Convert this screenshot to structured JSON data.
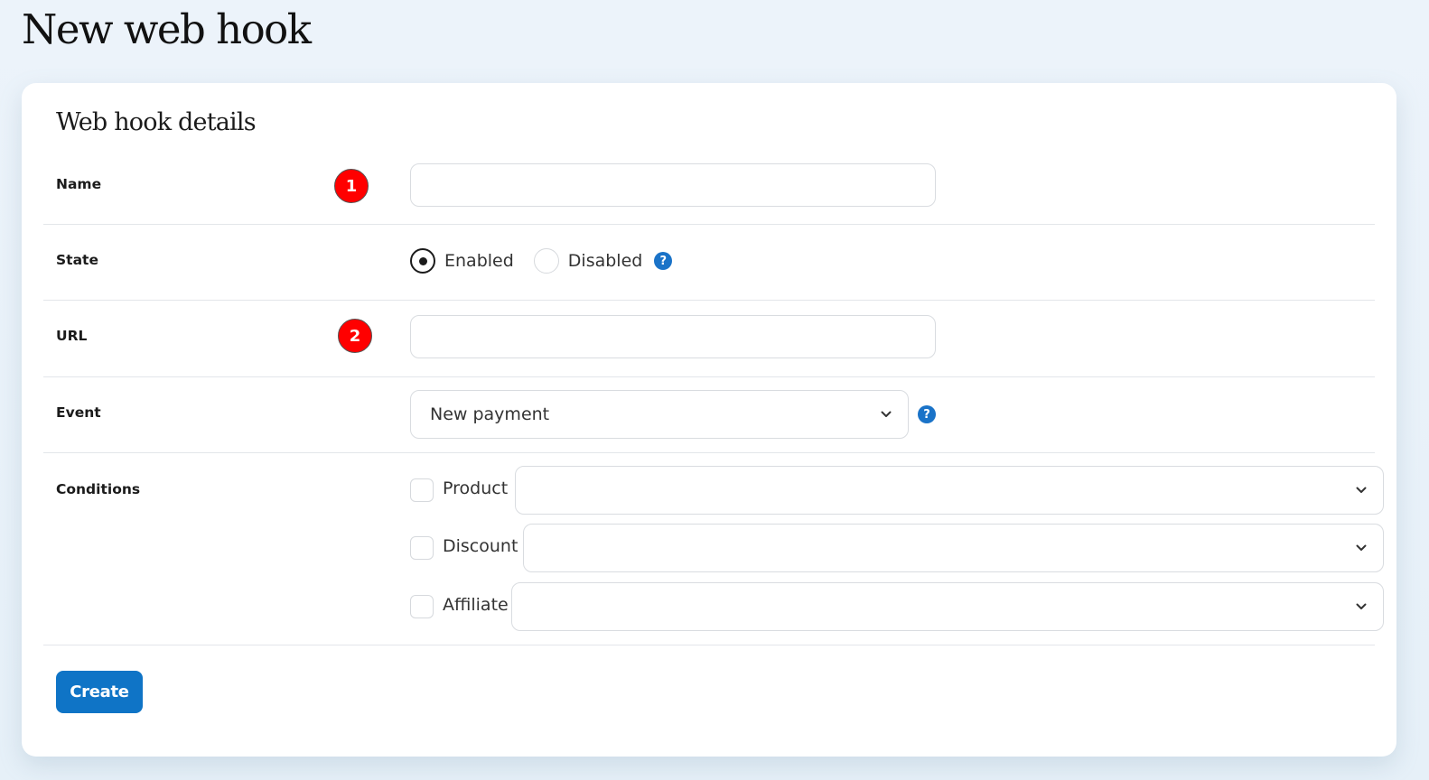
{
  "page": {
    "title": "New web hook"
  },
  "card": {
    "title": "Web hook details"
  },
  "form": {
    "name": {
      "label": "Name",
      "marker": "1",
      "value": ""
    },
    "state": {
      "label": "State",
      "options": [
        {
          "label": "Enabled",
          "selected": true
        },
        {
          "label": "Disabled",
          "selected": false
        }
      ],
      "help_icon": "?"
    },
    "url": {
      "label": "URL",
      "marker": "2",
      "value": ""
    },
    "event": {
      "label": "Event",
      "selected": "New payment",
      "help_icon": "?"
    },
    "conditions": {
      "label": "Conditions",
      "items": [
        {
          "label": "Product",
          "checked": false,
          "selected": ""
        },
        {
          "label": "Discount",
          "checked": false,
          "selected": ""
        },
        {
          "label": "Affiliate",
          "checked": false,
          "selected": ""
        }
      ]
    }
  },
  "actions": {
    "create_label": "Create"
  },
  "colors": {
    "primary": "#0f74c6",
    "help": "#1a73c8",
    "marker": "#ff0000",
    "page_background": "#ecf3fa",
    "card_background": "#ffffff"
  }
}
